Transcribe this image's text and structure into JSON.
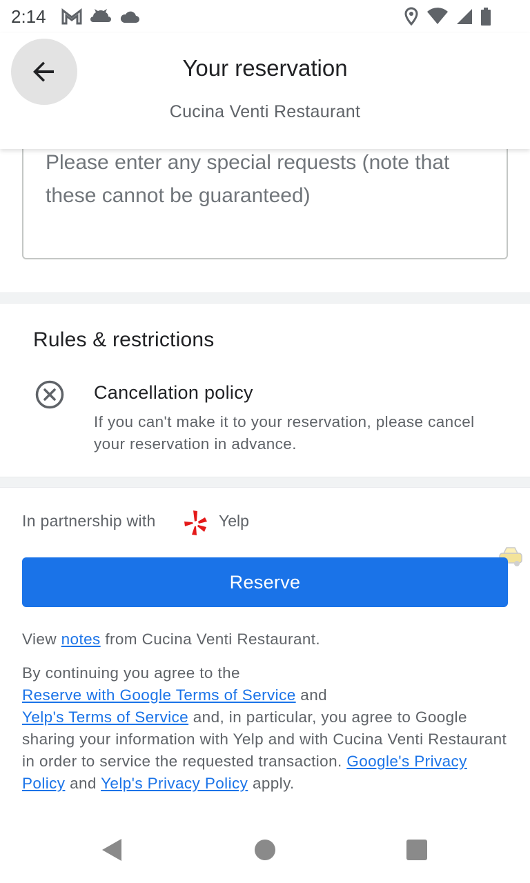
{
  "status_bar": {
    "time": "2:14",
    "left_icons": [
      "gmail-icon",
      "cloud-cat-icon",
      "cloud-icon"
    ],
    "right_icons": [
      "location-icon",
      "wifi-icon",
      "signal-icon",
      "battery-icon"
    ]
  },
  "header": {
    "title": "Your reservation",
    "subtitle": "Cucina Venti Restaurant",
    "back_icon": "arrow-back-icon"
  },
  "special_requests": {
    "placeholder": "Please enter any special requests (note that these cannot be guaranteed)"
  },
  "rules": {
    "title": "Rules & restrictions",
    "items": [
      {
        "icon": "cancel-circle-icon",
        "title": "Cancellation policy",
        "description": "If you can't make it to your reservation, please cancel your reservation in advance."
      }
    ]
  },
  "partnership": {
    "label": "In partnership with",
    "partner_name": "Yelp",
    "partner_icon": "yelp-icon"
  },
  "reserve_button": {
    "label": "Reserve"
  },
  "notes_line": {
    "prefix": "View",
    "link": "notes",
    "suffix": "from Cucina Venti Restaurant."
  },
  "legal": {
    "intro": "By continuing you agree to the",
    "link_google_tos": "Reserve with Google Terms of Service",
    "and_1": "and",
    "link_yelp_tos": "Yelp's Terms of Service",
    "middle": "and, in particular, you agree to Google sharing your information with Yelp and with Cucina Venti Restaurant in order to service the requested transaction.",
    "link_google_privacy": "Google's Privacy Policy",
    "and_2": "and",
    "link_yelp_privacy": "Yelp's Privacy Policy",
    "outro": "apply."
  },
  "colors": {
    "accent": "#1a73e8",
    "yelp_red": "#d32323"
  }
}
